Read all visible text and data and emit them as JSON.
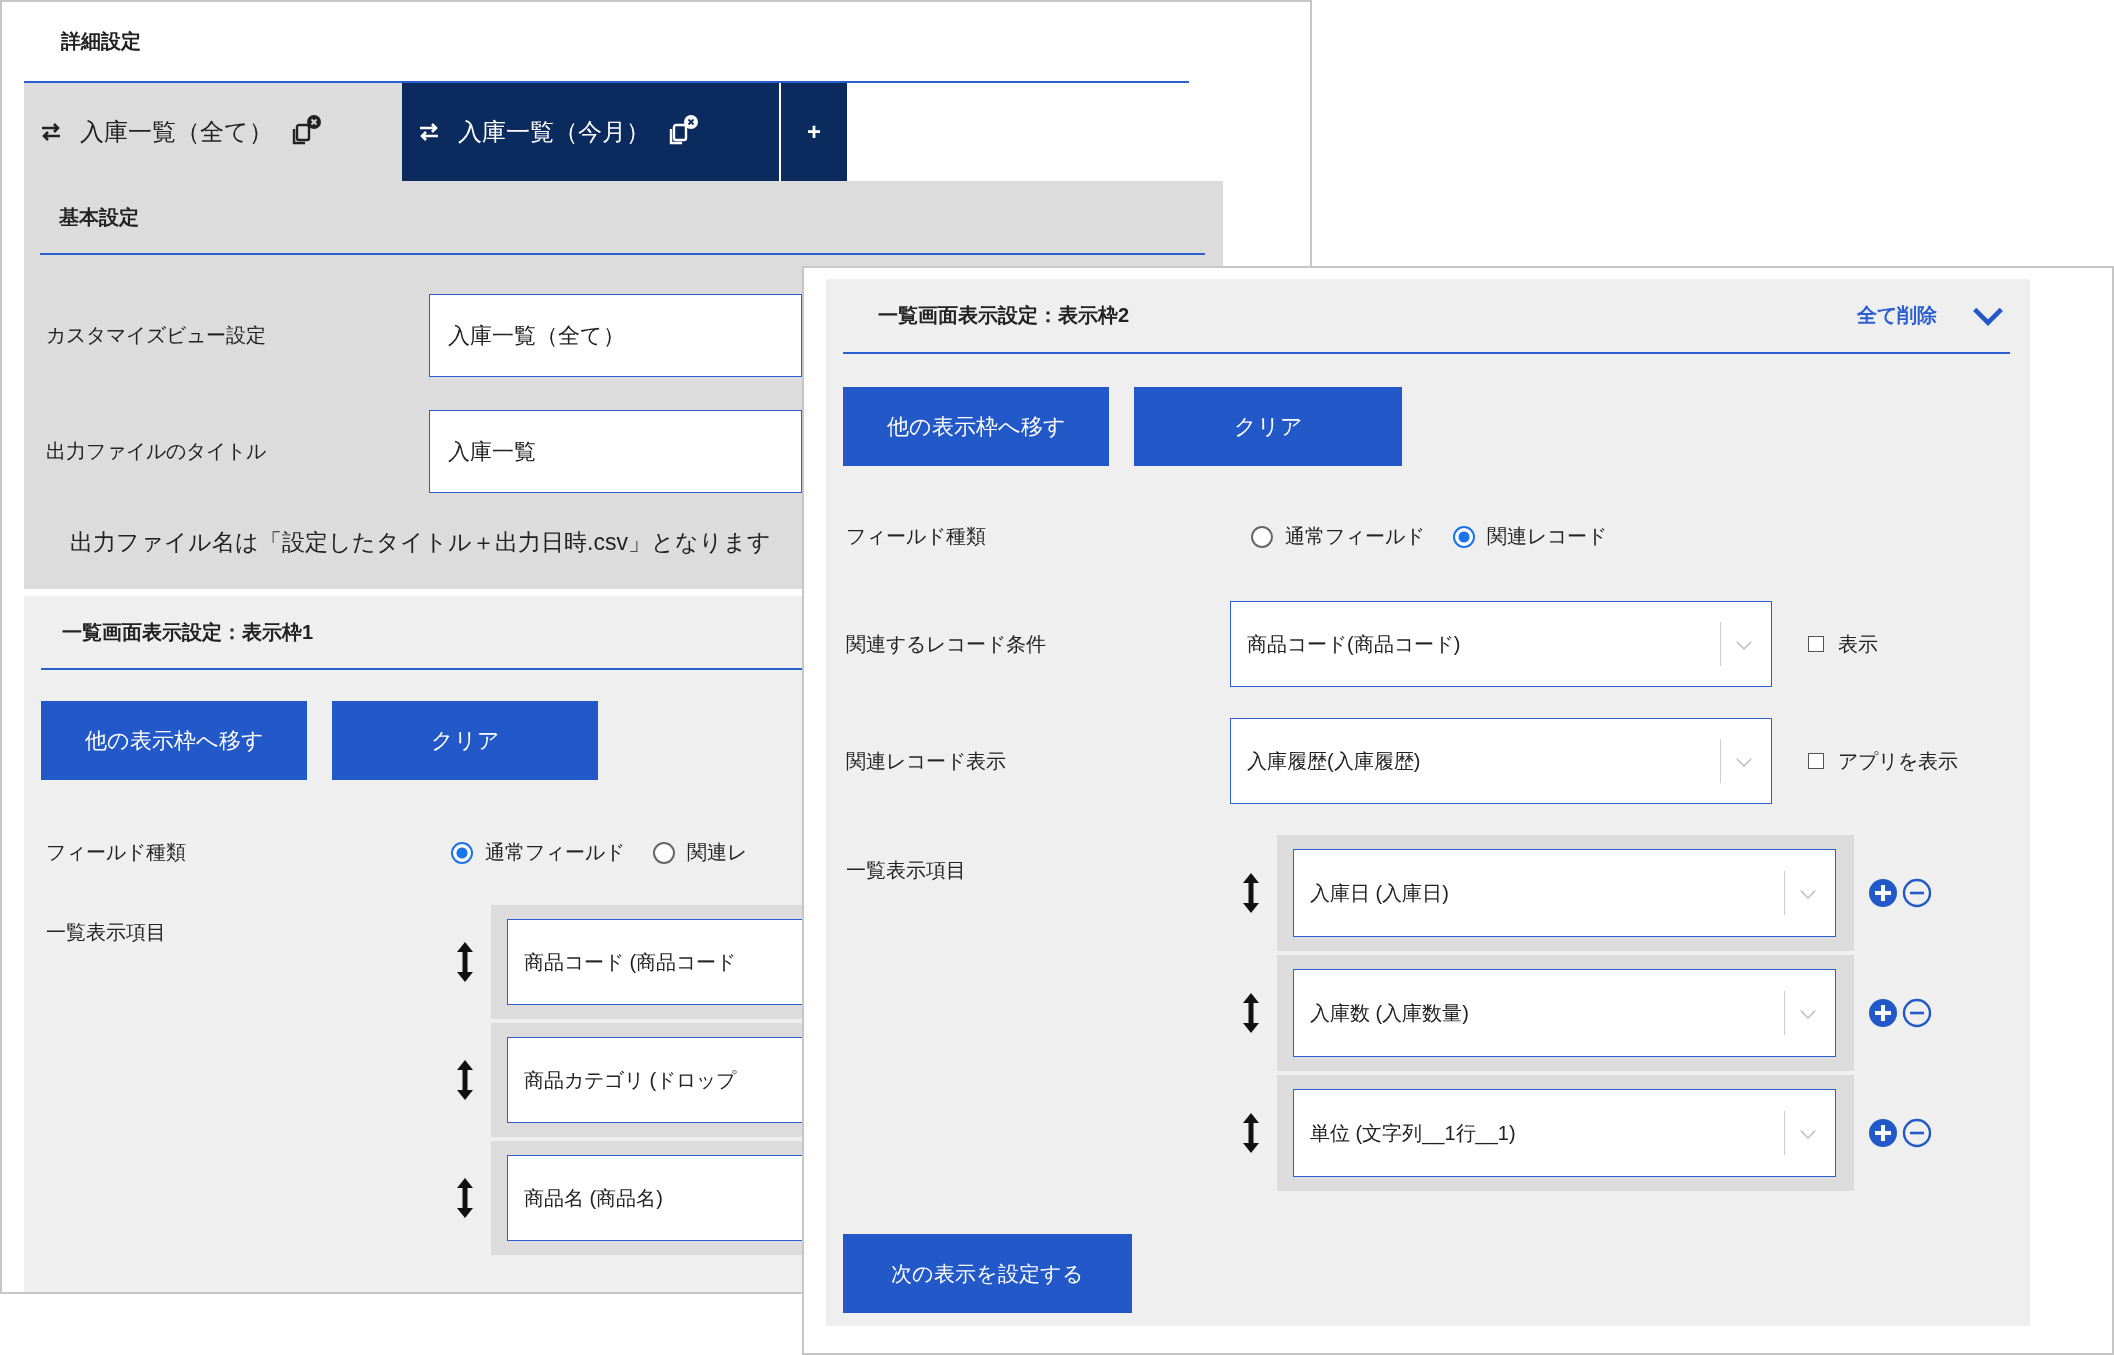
{
  "back_window": {
    "title": "詳細設定",
    "tabs": [
      {
        "label": "入庫一覧（全て）",
        "selected": true
      },
      {
        "label": "入庫一覧（今月）",
        "selected": false
      }
    ],
    "add_tab": "+",
    "basic_settings": {
      "heading": "基本設定",
      "fields": [
        {
          "label": "カスタマイズビュー設定",
          "value": "入庫一覧（全て）"
        },
        {
          "label": "出力ファイルのタイトル",
          "value": "入庫一覧"
        }
      ],
      "note": "出力ファイル名は「設定したタイトル＋出力日時.csv」となります"
    },
    "display_frame": {
      "heading": "一覧画面表示設定：表示枠1",
      "buttons": [
        "他の表示枠へ移す",
        "クリア"
      ],
      "field_type": {
        "label": "フィールド種類",
        "options": [
          {
            "label": "通常フィールド",
            "selected": true
          },
          {
            "label": "関連レ",
            "selected": false
          }
        ]
      },
      "list": {
        "label": "一覧表示項目",
        "items": [
          "商品コード (商品コード",
          "商品カテゴリ (ドロップ",
          "商品名 (商品名)"
        ]
      }
    }
  },
  "front_window": {
    "display_frame": {
      "heading": "一覧画面表示設定：表示枠2",
      "delete_all": "全て削除",
      "buttons": [
        "他の表示枠へ移す",
        "クリア"
      ],
      "field_type": {
        "label": "フィールド種類",
        "options": [
          {
            "label": "通常フィールド",
            "selected": false
          },
          {
            "label": "関連レコード",
            "selected": true
          }
        ]
      },
      "related": [
        {
          "label": "関連するレコード条件",
          "value": "商品コード(商品コード)",
          "checkbox": {
            "label": "表示",
            "checked": false
          }
        },
        {
          "label": "関連レコード表示",
          "value": "入庫履歴(入庫履歴)",
          "checkbox": {
            "label": "アプリを表示",
            "checked": false
          }
        }
      ],
      "list": {
        "label": "一覧表示項目",
        "items": [
          "入庫日 (入庫日)",
          "入庫数 (入庫数量)",
          "単位 (文字列__1行__1)"
        ]
      },
      "next_button": "次の表示を設定する"
    }
  }
}
